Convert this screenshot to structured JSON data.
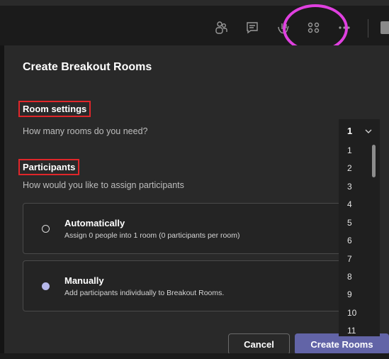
{
  "toolbar": {
    "icons": [
      "participants-icon",
      "chat-icon",
      "raise-hand-icon",
      "breakout-rooms-icon",
      "more-icon",
      "camera-icon"
    ]
  },
  "dialog": {
    "title": "Create Breakout Rooms",
    "room_settings": {
      "heading": "Room settings",
      "question": "How many rooms do you need?"
    },
    "participants": {
      "heading": "Participants",
      "question": "How would you like to assign participants"
    },
    "options": [
      {
        "title": "Automatically",
        "description": "Assign 0 people into 1 room (0 participants per room)",
        "selected": false
      },
      {
        "title": "Manually",
        "description": "Add participants individually to Breakout Rooms.",
        "selected": true
      }
    ],
    "buttons": {
      "cancel": "Cancel",
      "create": "Create Rooms"
    }
  },
  "room_count_dropdown": {
    "selected": "1",
    "options": [
      "1",
      "2",
      "3",
      "4",
      "5",
      "6",
      "7",
      "8",
      "9",
      "10",
      "11"
    ]
  },
  "colors": {
    "accent": "#6264a7",
    "annotation_ring": "#e040e0",
    "annotation_box": "#e0262a"
  }
}
